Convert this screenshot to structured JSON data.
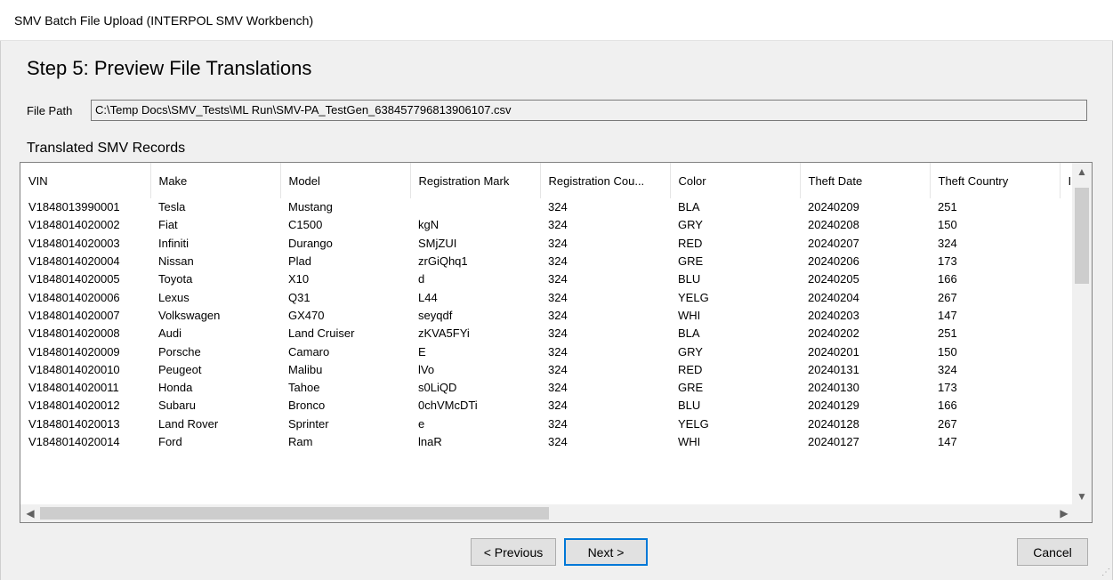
{
  "window": {
    "title": "SMV Batch File Upload (INTERPOL SMV Workbench)"
  },
  "step": {
    "title": "Step 5: Preview File Translations"
  },
  "file_path": {
    "label": "File Path",
    "value": "C:\\Temp Docs\\SMV_Tests\\ML Run\\SMV-PA_TestGen_638457796813906107.csv"
  },
  "records": {
    "title": "Translated SMV Records",
    "columns": [
      "VIN",
      "Make",
      "Model",
      "Registration Mark",
      "Registration Cou...",
      "Color",
      "Theft Date",
      "Theft Country",
      "I"
    ],
    "rows": [
      [
        "V1848013990001",
        "Tesla",
        "Mustang",
        "",
        "324",
        "BLA",
        "20240209",
        "251"
      ],
      [
        "V1848014020002",
        "Fiat",
        "C1500",
        "kgN",
        "324",
        "GRY",
        "20240208",
        "150"
      ],
      [
        "V1848014020003",
        "Infiniti",
        "Durango",
        "SMjZUI",
        "324",
        "RED",
        "20240207",
        "324"
      ],
      [
        "V1848014020004",
        "Nissan",
        "Plad",
        "zrGiQhq1",
        "324",
        "GRE",
        "20240206",
        "173"
      ],
      [
        "V1848014020005",
        "Toyota",
        "X10",
        "d",
        "324",
        "BLU",
        "20240205",
        "166"
      ],
      [
        "V1848014020006",
        "Lexus",
        "Q31",
        "L44",
        "324",
        "YELG",
        "20240204",
        "267"
      ],
      [
        "V1848014020007",
        "Volkswagen",
        "GX470",
        "seyqdf",
        "324",
        "WHI",
        "20240203",
        "147"
      ],
      [
        "V1848014020008",
        "Audi",
        "Land Cruiser",
        "zKVA5FYi",
        "324",
        "BLA",
        "20240202",
        "251"
      ],
      [
        "V1848014020009",
        "Porsche",
        "Camaro",
        "E",
        "324",
        "GRY",
        "20240201",
        "150"
      ],
      [
        "V1848014020010",
        "Peugeot",
        "Malibu",
        "lVo",
        "324",
        "RED",
        "20240131",
        "324"
      ],
      [
        "V1848014020011",
        "Honda",
        "Tahoe",
        "s0LiQD",
        "324",
        "GRE",
        "20240130",
        "173"
      ],
      [
        "V1848014020012",
        "Subaru",
        "Bronco",
        "0chVMcDTi",
        "324",
        "BLU",
        "20240129",
        "166"
      ],
      [
        "V1848014020013",
        "Land Rover",
        "Sprinter",
        "e",
        "324",
        "YELG",
        "20240128",
        "267"
      ],
      [
        "V1848014020014",
        "Ford",
        "Ram",
        "lnaR",
        "324",
        "WHI",
        "20240127",
        "147"
      ]
    ]
  },
  "icons": {
    "scroll_up": "▲",
    "scroll_down": "▼",
    "scroll_left": "◀",
    "scroll_right": "▶",
    "grip": "⋰"
  },
  "buttons": {
    "previous": "< Previous",
    "next": "Next >",
    "cancel": "Cancel"
  },
  "colors": {
    "accent": "#0078d7",
    "background": "#f0f0f0"
  }
}
